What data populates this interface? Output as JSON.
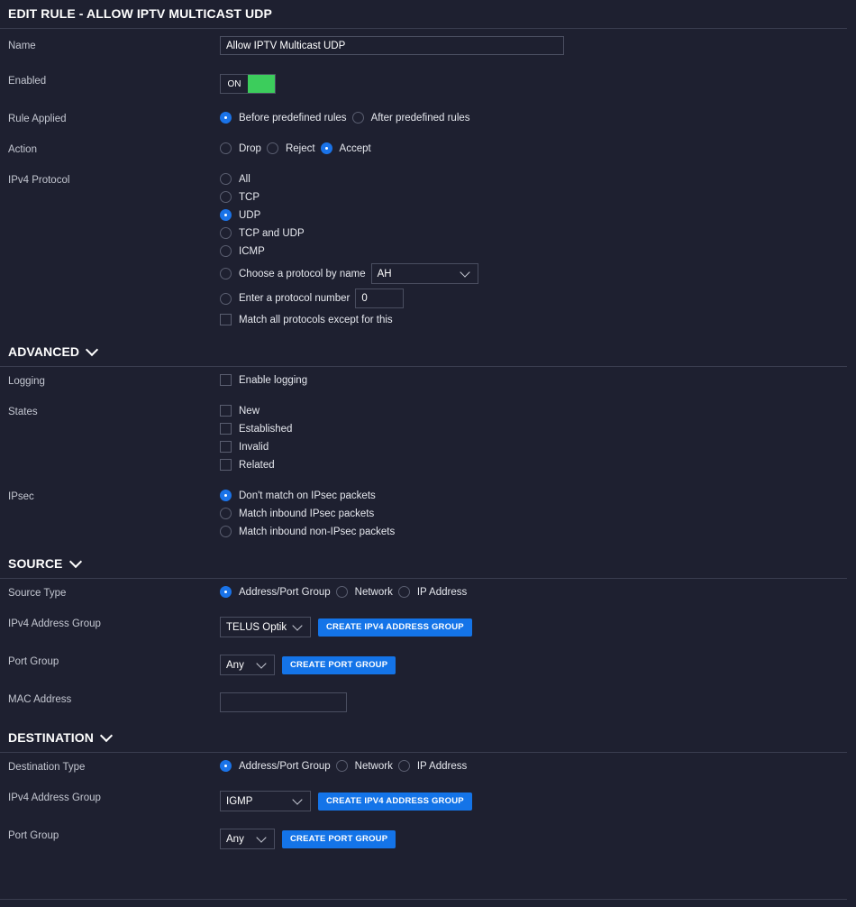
{
  "title": "EDIT RULE - ALLOW IPTV MULTICAST UDP",
  "general": {
    "name_label": "Name",
    "name_value": "Allow IPTV Multicast UDP",
    "enabled_label": "Enabled",
    "enabled_toggle": "ON",
    "rule_applied_label": "Rule Applied",
    "rule_before": "Before predefined rules",
    "rule_after": "After predefined rules",
    "action_label": "Action",
    "action_drop": "Drop",
    "action_reject": "Reject",
    "action_accept": "Accept",
    "protocol_label": "IPv4 Protocol",
    "proto_all": "All",
    "proto_tcp": "TCP",
    "proto_udp": "UDP",
    "proto_tcpudp": "TCP and UDP",
    "proto_icmp": "ICMP",
    "proto_byname": "Choose a protocol by name",
    "proto_byname_value": "AH",
    "proto_bynumber": "Enter a protocol number",
    "proto_bynumber_value": "0",
    "proto_except": "Match all protocols except for this"
  },
  "advanced": {
    "heading": "ADVANCED",
    "logging_label": "Logging",
    "enable_logging": "Enable logging",
    "states_label": "States",
    "state_new": "New",
    "state_established": "Established",
    "state_invalid": "Invalid",
    "state_related": "Related",
    "ipsec_label": "IPsec",
    "ipsec_dont": "Don't match on IPsec packets",
    "ipsec_inbound": "Match inbound IPsec packets",
    "ipsec_non": "Match inbound non-IPsec packets"
  },
  "source": {
    "heading": "SOURCE",
    "type_label": "Source Type",
    "type_addr": "Address/Port Group",
    "type_network": "Network",
    "type_ip": "IP Address",
    "group_label": "IPv4 Address Group",
    "group_value": "TELUS Optik",
    "create_group_btn": "CREATE IPV4 ADDRESS GROUP",
    "port_label": "Port Group",
    "port_value": "Any",
    "create_port_btn": "CREATE PORT GROUP",
    "mac_label": "MAC Address",
    "mac_value": ""
  },
  "destination": {
    "heading": "DESTINATION",
    "type_label": "Destination Type",
    "type_addr": "Address/Port Group",
    "type_network": "Network",
    "type_ip": "IP Address",
    "group_label": "IPv4 Address Group",
    "group_value": "IGMP",
    "create_group_btn": "CREATE IPV4 ADDRESS GROUP",
    "port_label": "Port Group",
    "port_value": "Any",
    "create_port_btn": "CREATE PORT GROUP"
  },
  "colors": {
    "background": "#1e2030",
    "accent": "#1474e8",
    "toggle_on": "#3ccd5c"
  }
}
